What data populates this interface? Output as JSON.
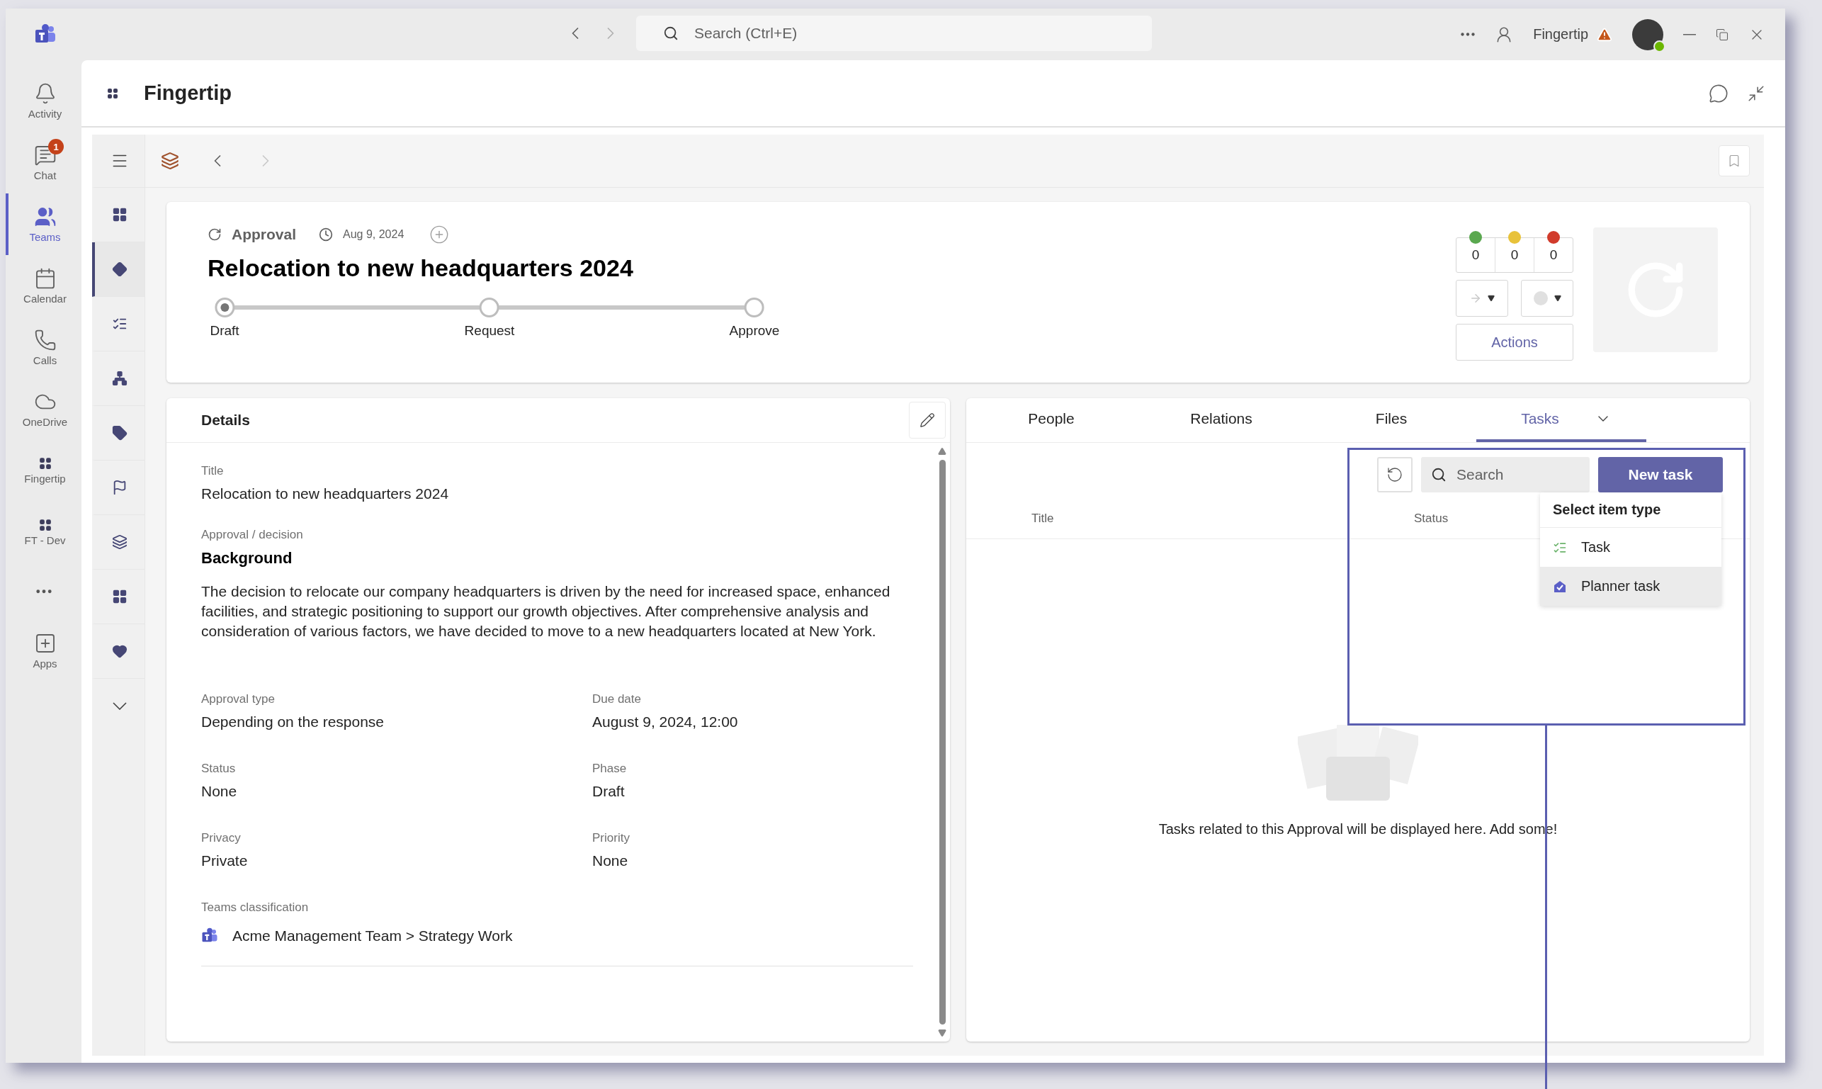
{
  "title_bar": {
    "search_placeholder": "Search (Ctrl+E)",
    "account_name": "Fingertip"
  },
  "rail": [
    {
      "label": "Activity",
      "selected": false
    },
    {
      "label": "Chat",
      "selected": false,
      "badge": "1"
    },
    {
      "label": "Teams",
      "selected": true
    },
    {
      "label": "Calendar",
      "selected": false
    },
    {
      "label": "Calls",
      "selected": false
    },
    {
      "label": "OneDrive",
      "selected": false
    },
    {
      "label": "Fingertip",
      "selected": false
    },
    {
      "label": "FT - Dev",
      "selected": false
    },
    {
      "label": "Apps",
      "selected": false
    }
  ],
  "app": {
    "title": "Fingertip"
  },
  "side_nav": [
    {
      "selected": false
    },
    {
      "selected": true
    },
    {
      "selected": false
    },
    {
      "selected": false
    },
    {
      "selected": false
    },
    {
      "selected": false
    },
    {
      "selected": false
    },
    {
      "selected": false
    },
    {
      "selected": false
    }
  ],
  "header": {
    "type": "Approval",
    "date": "Aug 9, 2024",
    "title": "Relocation to new headquarters 2024",
    "phases": [
      {
        "label": "Draft",
        "selected": true
      },
      {
        "label": "Request",
        "selected": false
      },
      {
        "label": "Approve",
        "selected": false
      }
    ],
    "counters": [
      {
        "value": "0",
        "color": "#5aa84f"
      },
      {
        "value": "0",
        "color": "#e8c23a"
      },
      {
        "value": "0",
        "color": "#d13b2b"
      }
    ],
    "actions_label": "Actions"
  },
  "details": {
    "heading": "Details",
    "title_label": "Title",
    "title_value": "Relocation to new headquarters 2024",
    "decision_label": "Approval / decision",
    "background_heading": "Background",
    "background_text": "The decision to relocate our company headquarters is driven by the need for increased space, enhanced facilities, and strategic positioning to support our growth objectives. After comprehensive analysis and consideration of various factors, we have decided to move to a new headquarters located at New York.",
    "fields": [
      {
        "label": "Approval type",
        "value": "Depending on the response"
      },
      {
        "label": "Due date",
        "value": "August 9, 2024, 12:00"
      },
      {
        "label": "Status",
        "value": "None"
      },
      {
        "label": "Phase",
        "value": "Draft"
      },
      {
        "label": "Privacy",
        "value": "Private"
      },
      {
        "label": "Priority",
        "value": "None"
      }
    ],
    "classification_label": "Teams classification",
    "classification_value": "Acme Management Team > Strategy Work"
  },
  "tabs": [
    {
      "label": "People",
      "selected": false
    },
    {
      "label": "Relations",
      "selected": false
    },
    {
      "label": "Files",
      "selected": false
    },
    {
      "label": "Tasks",
      "selected": true
    }
  ],
  "tasks": {
    "search_placeholder": "Search",
    "new_button": "New task",
    "columns": [
      "Title",
      "Status"
    ],
    "menu": {
      "heading": "Select item type",
      "items": [
        {
          "label": "Task",
          "kind": "task",
          "hovered": false
        },
        {
          "label": "Planner task",
          "kind": "planner",
          "hovered": true
        }
      ]
    },
    "empty_text": "Tasks related to this Approval will be displayed here. Add some!"
  }
}
